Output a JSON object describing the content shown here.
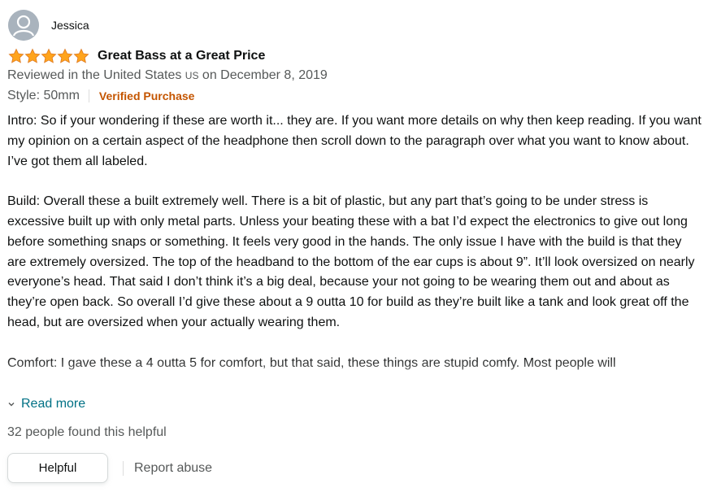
{
  "colors": {
    "star": "#FFA41C",
    "star_outline": "#DE7921",
    "link": "#007185",
    "verified": "#C45500",
    "secondary_text": "#565959",
    "text": "#0F1111"
  },
  "review": {
    "profile": {
      "avatar_icon": "default-user-avatar",
      "name": "Jessica"
    },
    "rating": 5,
    "star_icon": "star-icon",
    "title": "Great Bass at a Great Price",
    "date_prefix": "Reviewed in the United States",
    "country_code": "US",
    "date_suffix": "on December 8, 2019",
    "style": "Style: 50mm",
    "verified_label": "Verified Purchase",
    "body": [
      "Intro: So if your wondering if these are worth it... they are. If you want more details on why then keep reading. If you want my opinion on a certain aspect of the headphone then scroll down to the paragraph over what you want to know about. I’ve got them all labeled.",
      "Build: Overall these a built extremely well. There is a bit of plastic, but any part that’s going to be under stress is excessive built up with only metal parts. Unless your beating these with a bat I’d expect the electronics to give out long before something snaps or something. It feels very good in the hands. The only issue I have with the build is that they are extremely oversized. The top of the headband to the bottom of the ear cups is about 9”. It’ll look oversized on nearly everyone’s head. That said I don’t think it’s a big deal, because your not going to be wearing them out and about as they’re open back. So overall I’d give these about a 9 outta 10 for build as they’re built like a tank and look great off the head, but are oversized when your actually wearing them.",
      "Comfort: I gave these a 4 outta 5 for comfort, but that said, these things are stupid comfy. Most people will"
    ],
    "read_more_label": "Read more",
    "read_more_icon": "chevron-down-icon",
    "helpful_count_text": "32 people found this helpful",
    "helpful_button_label": "Helpful",
    "report_abuse_label": "Report abuse"
  }
}
